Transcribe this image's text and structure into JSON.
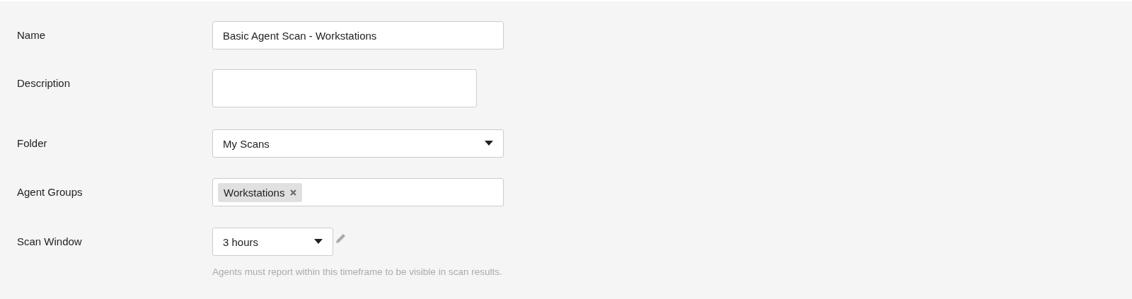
{
  "fields": [
    {
      "kind": "text",
      "label": "Name",
      "value": "Basic Agent Scan - Workstations"
    },
    {
      "kind": "textarea",
      "label": "Description"
    },
    {
      "kind": "select",
      "label": "Folder",
      "value": "My Scans"
    },
    {
      "kind": "tags",
      "label": "Agent Groups",
      "tags": [
        "Workstations"
      ]
    },
    {
      "kind": "small-select",
      "label": "Scan Window",
      "value": "3 hours",
      "help": "Agents must report within this timeframe to be visible in scan results."
    }
  ]
}
